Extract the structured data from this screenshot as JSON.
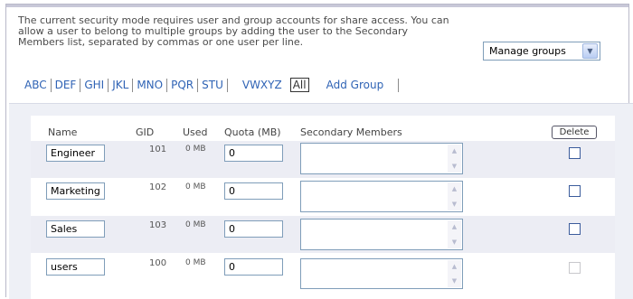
{
  "intro_text": "The current security mode requires user and group accounts for share access. You can allow a user to belong to multiple groups by adding the user to the Secondary Members list, separated by commas or one user per line.",
  "manage_select": {
    "value": "Manage groups"
  },
  "alpha_tabs": [
    "ABC",
    "DEF",
    "GHI",
    "JKL",
    "MNO",
    "PQR",
    "STU"
  ],
  "alpha_tab_extra": "VWXYZ",
  "alpha_all": "All",
  "add_group": "Add Group",
  "table": {
    "headers": {
      "name": "Name",
      "gid": "GID",
      "used": "Used",
      "quota": "Quota (MB)",
      "secondary": "Secondary Members"
    },
    "delete_label": "Delete",
    "rows": [
      {
        "name": "Engineer",
        "gid": "101",
        "used": "0 MB",
        "quota": "0",
        "secondary": "",
        "checkbox_enabled": true
      },
      {
        "name": "Marketing",
        "gid": "102",
        "used": "0 MB",
        "quota": "0",
        "secondary": "",
        "checkbox_enabled": true
      },
      {
        "name": "Sales",
        "gid": "103",
        "used": "0 MB",
        "quota": "0",
        "secondary": "",
        "checkbox_enabled": true
      },
      {
        "name": "users",
        "gid": "100",
        "used": "0 MB",
        "quota": "0",
        "secondary": "",
        "checkbox_enabled": false
      }
    ]
  },
  "colors": {
    "link": "#2f63b5",
    "panel": "#eef0f6",
    "row_shade": "#ecedf4"
  }
}
